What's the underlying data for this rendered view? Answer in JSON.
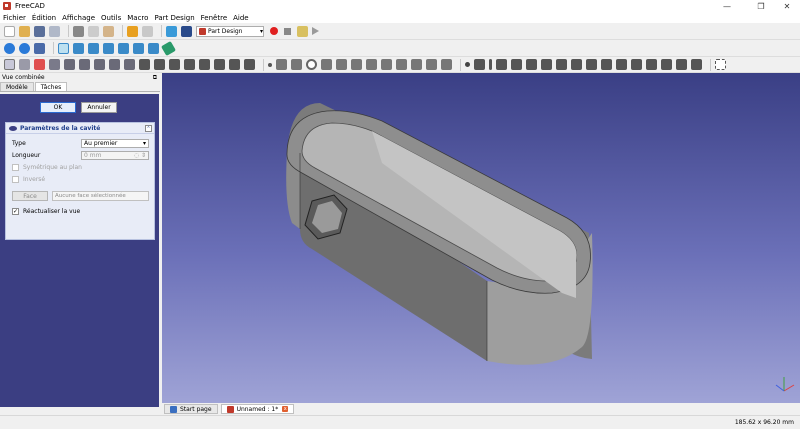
{
  "window": {
    "title": "FreeCAD",
    "minimize": "—",
    "maximize": "❐",
    "close": "✕"
  },
  "menu": [
    "Fichier",
    "Édition",
    "Affichage",
    "Outils",
    "Macro",
    "Part Design",
    "Fenêtre",
    "Aide"
  ],
  "toolbar": {
    "workbench": "Part Design",
    "workbench_arrow": "▾"
  },
  "panel": {
    "title": "Vue combinée",
    "title_icon": "⧉",
    "tabs": [
      "Modèle",
      "Tâches"
    ],
    "ok_label": "OK",
    "cancel_label": "Annuler",
    "task": {
      "header": "Paramètres de la cavité",
      "collapse": "⌃",
      "type_label": "Type",
      "type_value": "Au premier",
      "type_arrow": "▾",
      "length_label": "Longueur",
      "length_value": "0 mm",
      "spin_glyph": "◌ ⇕",
      "symmetric_label": "Symétrique au plan",
      "reversed_label": "Inversé",
      "face_button": "Face",
      "face_value": "Aucune face sélectionnée",
      "refresh_label": "Réactualiser la vue",
      "check_glyph": "✓"
    }
  },
  "doc_tabs": [
    {
      "label": "Start page",
      "icon_color": "#3a6fc0"
    },
    {
      "label": "Unnamed : 1*",
      "icon_color": "#c0392b",
      "close": "x"
    }
  ],
  "status": {
    "dims": "185.62 x 96.20 mm"
  },
  "colors": {
    "accent": "#3b3e82",
    "brand": "#c0392b"
  }
}
